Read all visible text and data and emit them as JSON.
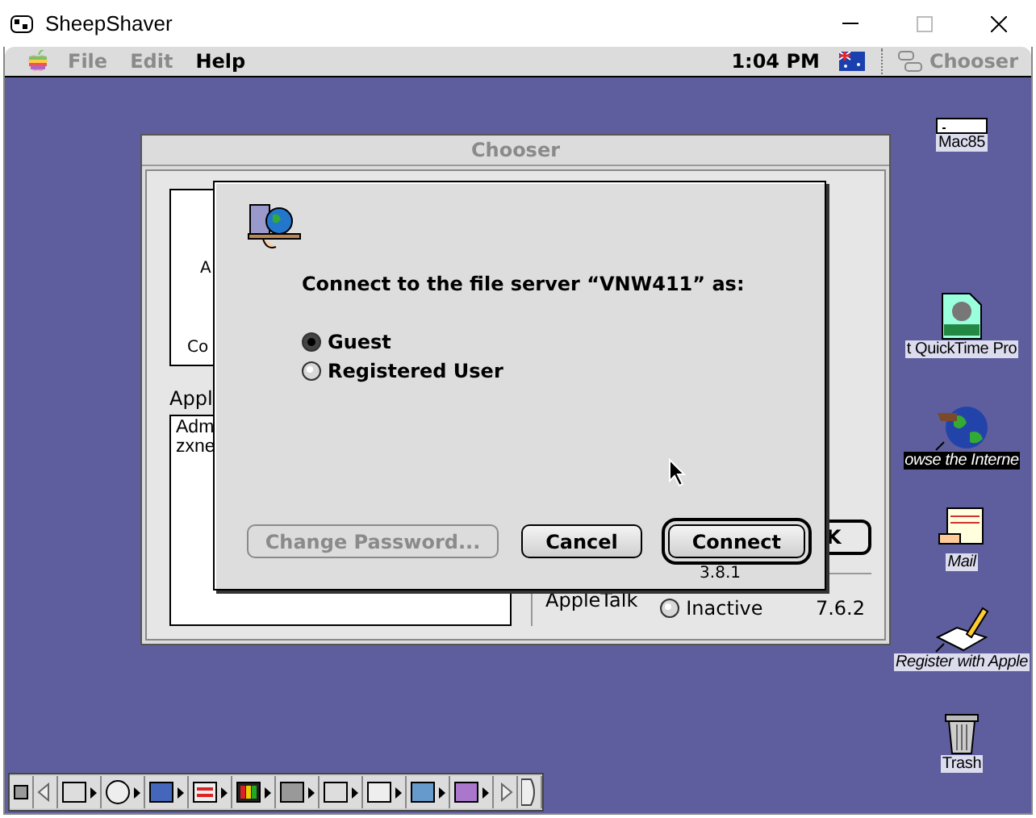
{
  "host_window": {
    "title": "SheepShaver"
  },
  "menu_bar": {
    "menus": [
      {
        "label": "File",
        "disabled": true
      },
      {
        "label": "Edit",
        "disabled": true
      },
      {
        "label": "Help",
        "disabled": false
      }
    ],
    "clock": "1:04 PM",
    "application": {
      "label": "Chooser",
      "disabled": true
    }
  },
  "chooser": {
    "title": "Chooser",
    "type_fragments": [
      "A",
      "Co"
    ],
    "list_label": "Appl",
    "list_items": [
      "Adm",
      "zxne"
    ],
    "ok_button": "K",
    "connection_label": "AppleTalk",
    "connection_options": [
      {
        "label": "Inactive",
        "selected": false
      }
    ],
    "version": "7.6.2"
  },
  "dialog": {
    "message": "Connect to the file server “VNW411” as:",
    "options": [
      {
        "label": "Guest",
        "selected": true
      },
      {
        "label": "Registered User",
        "selected": false
      }
    ],
    "buttons": [
      {
        "label": "Change Password...",
        "kind": "plain",
        "disabled": true
      },
      {
        "label": "Cancel",
        "kind": "plain",
        "disabled": false
      },
      {
        "label": "Connect",
        "kind": "default",
        "disabled": false
      }
    ],
    "version": "3.8.1"
  },
  "desktop_icons": [
    {
      "label": "Mac85",
      "kind": "drive",
      "alias": false,
      "selected": false
    },
    {
      "label": "t QuickTime Pro",
      "kind": "movie",
      "alias": false,
      "selected": false
    },
    {
      "label": "owse the Interne",
      "kind": "globe",
      "alias": true,
      "selected": true
    },
    {
      "label": "Mail",
      "kind": "mail",
      "alias": true,
      "selected": false
    },
    {
      "label": "Register with Apple",
      "kind": "register",
      "alias": true,
      "selected": false
    },
    {
      "label": "Trash",
      "kind": "trash",
      "alias": false,
      "selected": false
    }
  ]
}
